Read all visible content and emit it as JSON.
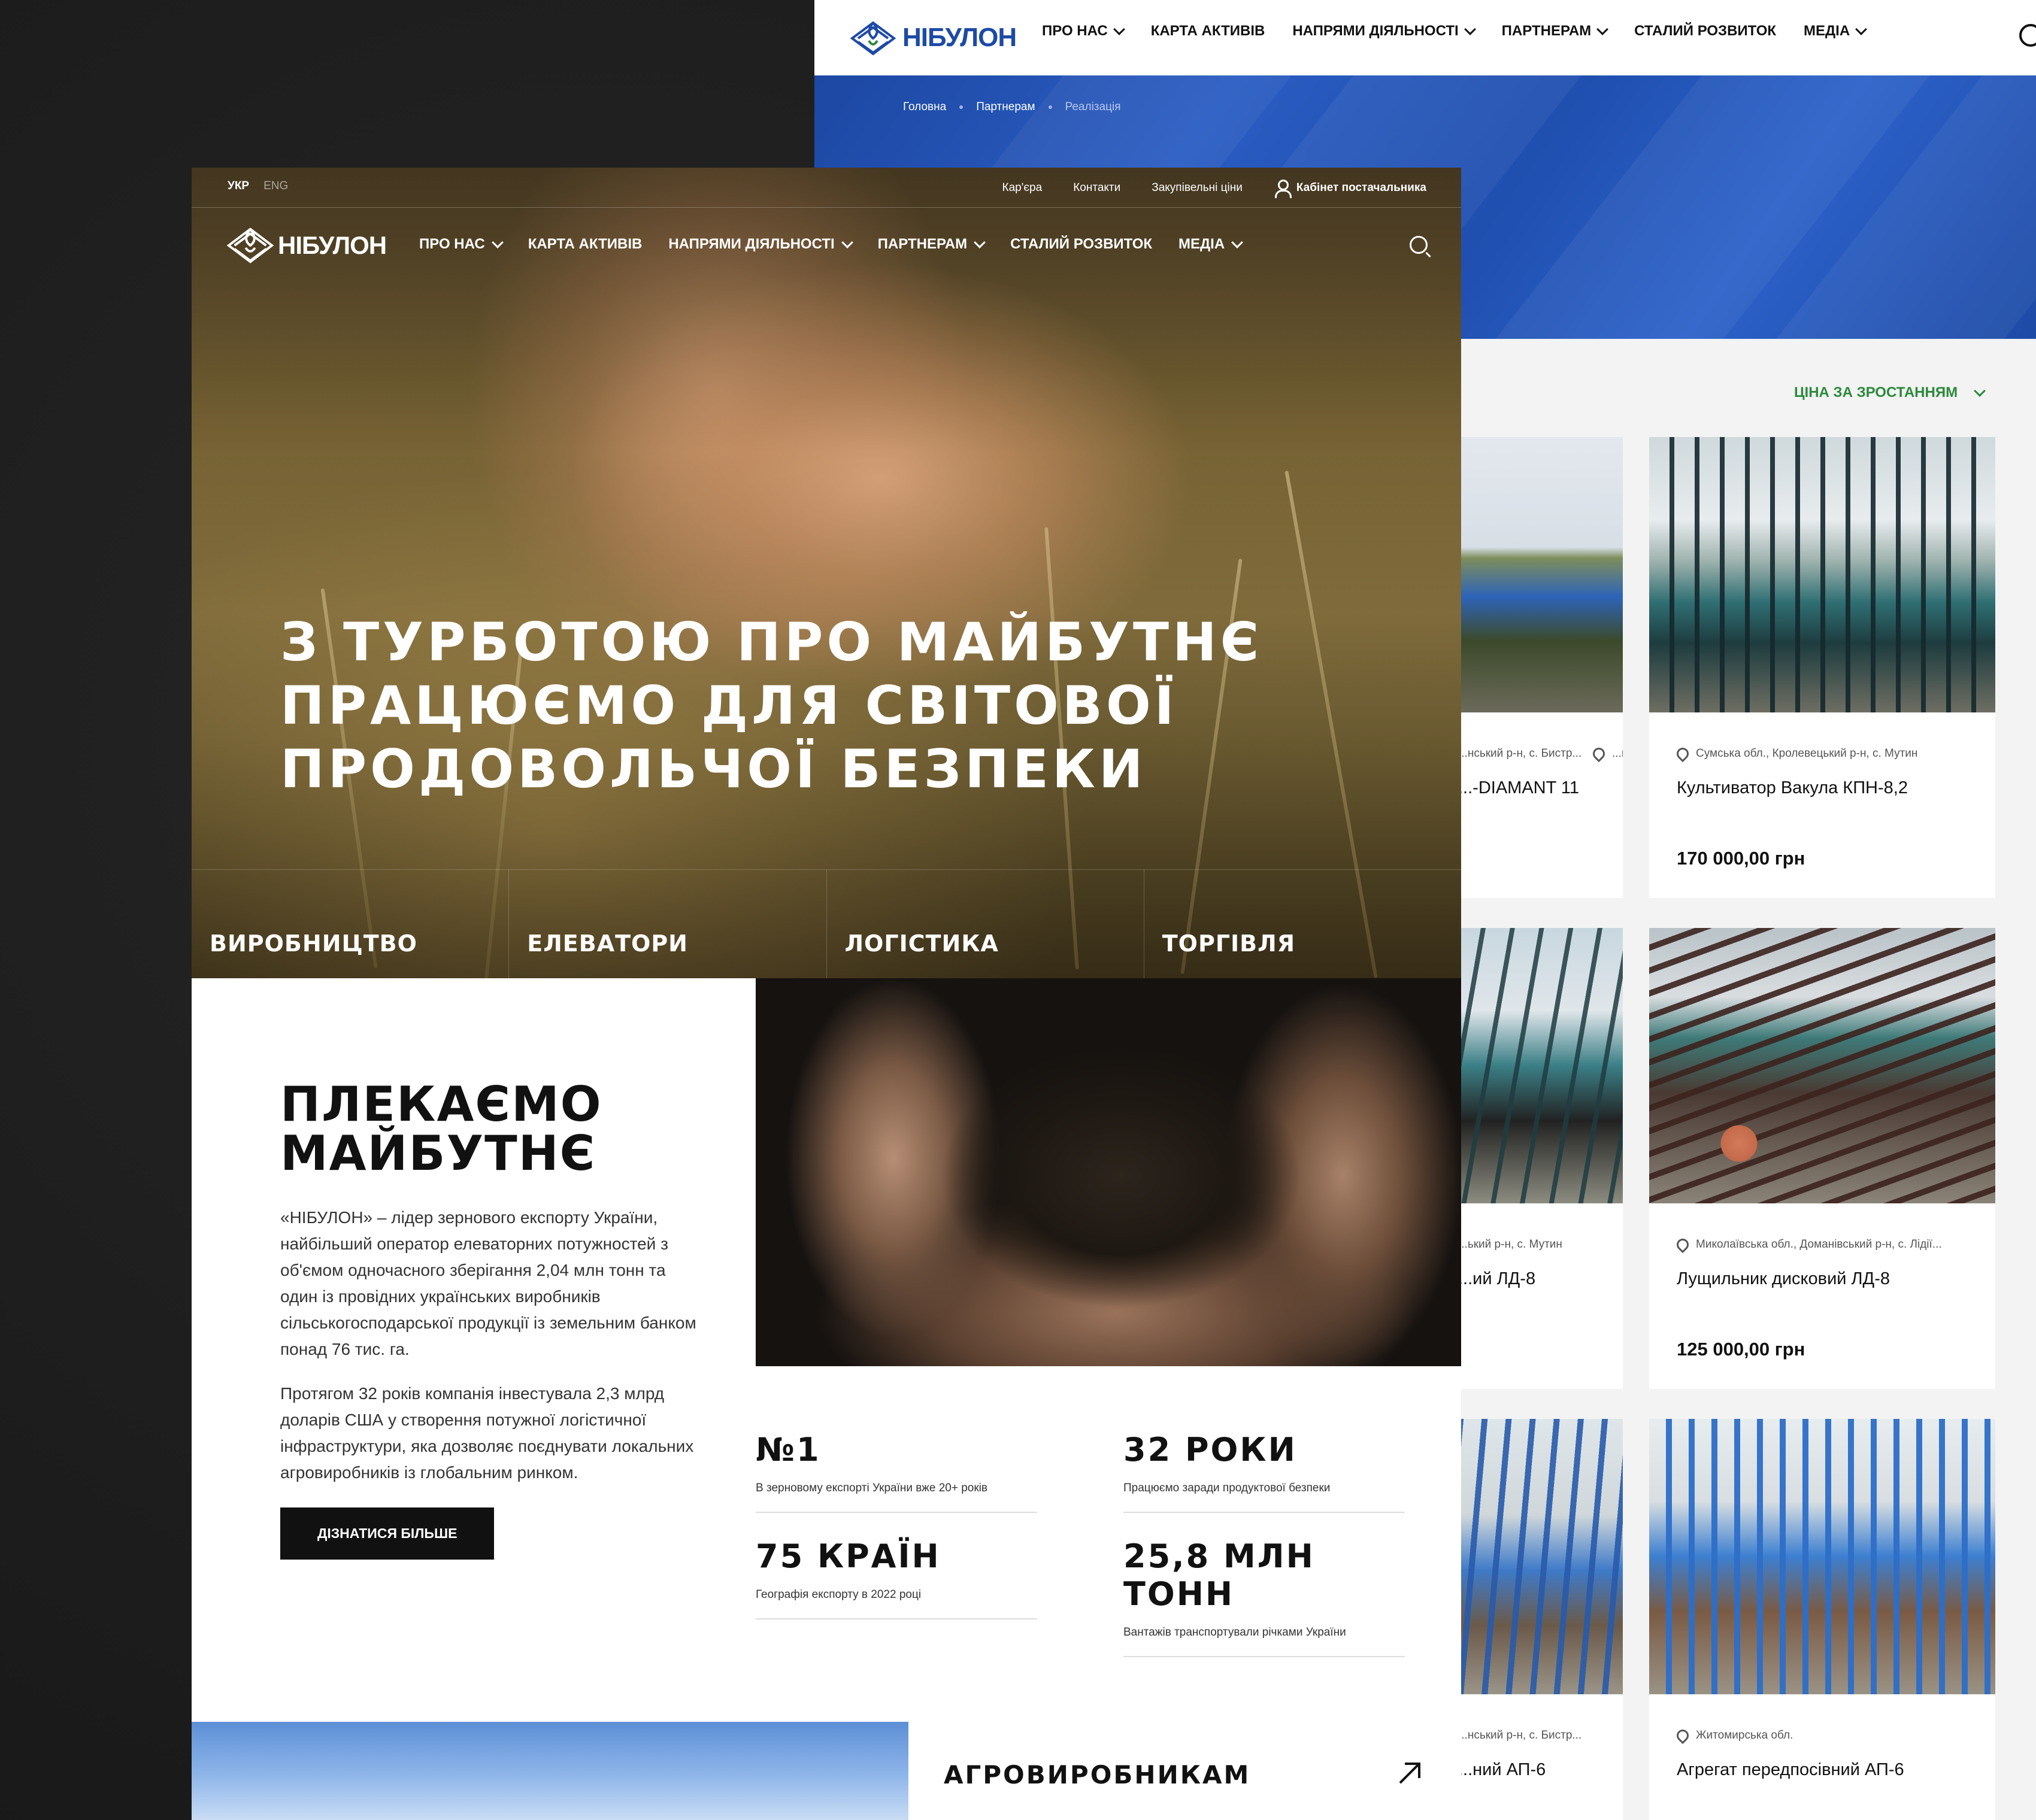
{
  "back": {
    "logo_text": "НІБУЛОН",
    "nav": [
      {
        "label": "ПРО НАС",
        "has_dropdown": true
      },
      {
        "label": "КАРТА АКТИВІВ",
        "has_dropdown": false
      },
      {
        "label": "НАПРЯМИ ДІЯЛЬНОСТІ",
        "has_dropdown": true
      },
      {
        "label": "ПАРТНЕРАМ",
        "has_dropdown": true
      },
      {
        "label": "СТАЛИЙ РОЗВИТОК",
        "has_dropdown": false
      },
      {
        "label": "МЕДІА",
        "has_dropdown": true
      }
    ],
    "breadcrumbs": [
      "Головна",
      "Партнерам",
      "Реалізація"
    ],
    "sort_label": "ЦІНА ЗА ЗРОСТАННЯМ",
    "products": [
      {
        "location": "...нський р-н, с. Бистр...",
        "title": "...-DIAMANT 11",
        "price": "",
        "photo": "blue-cultivator"
      },
      {
        "location": "Сумська обл., Кролевецький р-н, с. Мутин",
        "title": "Культиватор Вакула КПН-8,2",
        "price": "170 000,00 грн",
        "photo": "teal-cultivator"
      },
      {
        "location": "...ький р-н, с. Мутин",
        "title": "...ий ЛД-8",
        "price": "",
        "photo": "teal-disc"
      },
      {
        "location": "Миколаївська обл., Доманівський р-н, с. Лідії...",
        "title": "Лущильник дисковий ЛД-8",
        "price": "125 000,00 грн",
        "photo": "red-disc-harrow"
      },
      {
        "location": "...нський р-н, с. Бистр...",
        "title": "...ний АП-6",
        "price": "",
        "photo": "blue-aggregate"
      },
      {
        "location": "Житомирська обл.",
        "title": "Агрегат передпосівний АП-6",
        "price": "",
        "photo": "blue-aggregate-2"
      }
    ]
  },
  "front": {
    "lang": {
      "active": "УКР",
      "other": "ENG"
    },
    "util_links": [
      "Кар'єра",
      "Контакти",
      "Закупівельні ціни"
    ],
    "cabinet_label": "Кабінет постачальника",
    "logo_text": "НІБУЛОН",
    "nav": [
      {
        "label": "ПРО НАС",
        "has_dropdown": true
      },
      {
        "label": "КАРТА АКТИВІВ",
        "has_dropdown": false
      },
      {
        "label": "НАПРЯМИ ДІЯЛЬНОСТІ",
        "has_dropdown": true
      },
      {
        "label": "ПАРТНЕРАМ",
        "has_dropdown": true
      },
      {
        "label": "СТАЛИЙ РОЗВИТОК",
        "has_dropdown": false
      },
      {
        "label": "МЕДІА",
        "has_dropdown": true
      }
    ],
    "headline": [
      "З ТУРБОТОЮ ПРО МАЙБУТНЄ",
      "ПРАЦЮЄМО ДЛЯ СВІТОВОЇ",
      "ПРОДОВОЛЬЧОЇ БЕЗПЕКИ"
    ],
    "directions": [
      "ВИРОБНИЦТВО",
      "ЕЛЕВАТОРИ",
      "ЛОГІСТИКА",
      "ТОРГІВЛЯ"
    ],
    "about": {
      "title_line1": "ПЛЕКАЄМО",
      "title_line2": "МАЙБУТНЄ",
      "p1": "«НІБУЛОН» – лідер зернового експорту України, найбільший оператор елеваторних потужностей з об'ємом одночасного зберігання 2,04 млн тонн та один із провідних українських виробників сільськогосподарської продукції із земельним банком понад 76 тис. га.",
      "p2": "Протягом 32 років компанія інвестувала 2,3 млрд доларів США у створення потужної логістичної інфраструктури, яка дозволяє поєднувати локальних агровиробників із глобальним ринком.",
      "button": "ДІЗНАТИСЯ БІЛЬШЕ"
    },
    "stats": [
      {
        "value": "№1",
        "desc": "В зерновому експорті України вже 20+ років"
      },
      {
        "value": "32 РОКИ",
        "desc": "Працюємо заради продуктової безпеки"
      },
      {
        "value": "75 КРАЇН",
        "desc": "Географія експорту в 2022 році"
      },
      {
        "value": "25,8 МЛН ТОНН",
        "desc": "Вантажів транспортували річками України"
      }
    ],
    "agro_label": "АГРОВИРОБНИКАМ"
  },
  "colors": {
    "brand_blue": "#1d4aa6",
    "sort_green": "#2a8a3a",
    "dark": "#111111"
  }
}
